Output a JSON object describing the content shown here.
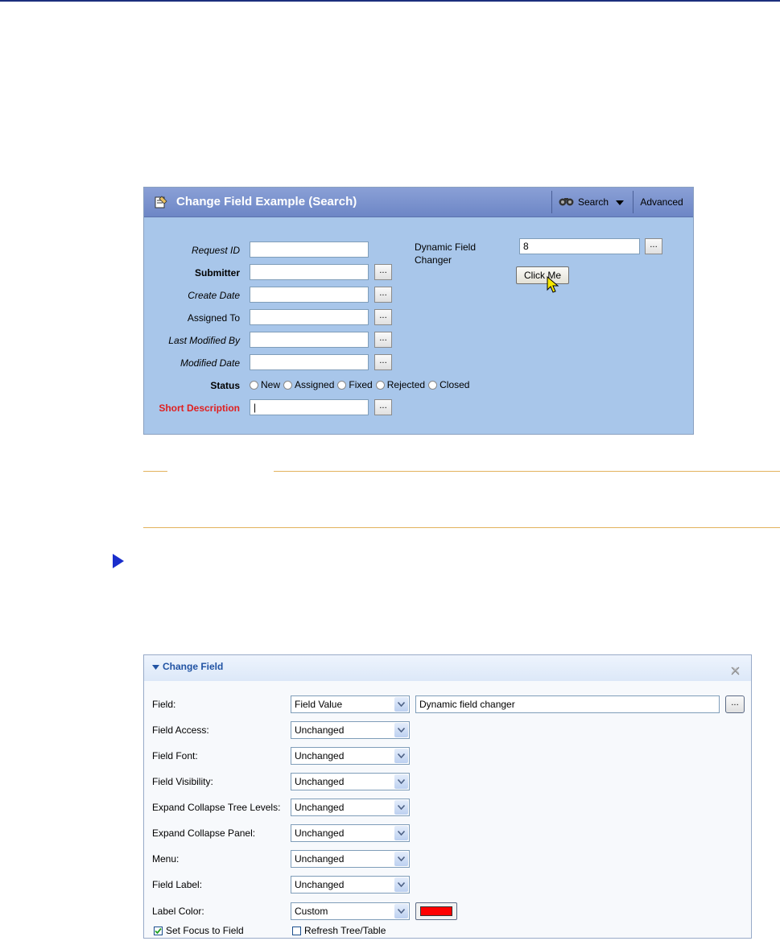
{
  "search_form": {
    "title": "Change Field Example (Search)",
    "search_label": "Search",
    "advanced_label": "Advanced",
    "fields": [
      {
        "label": "Request ID",
        "style": "italic",
        "has_button": false
      },
      {
        "label": "Submitter",
        "style": "bold",
        "has_button": true
      },
      {
        "label": "Create Date",
        "style": "italic",
        "has_button": true
      },
      {
        "label": "Assigned To",
        "style": "normal",
        "has_button": true
      },
      {
        "label": "Last Modified By",
        "style": "italic",
        "has_button": true
      },
      {
        "label": "Modified Date",
        "style": "italic",
        "has_button": true
      }
    ],
    "status": {
      "label": "Status",
      "options": [
        "New",
        "Assigned",
        "Fixed",
        "Rejected",
        "Closed"
      ]
    },
    "short_description": {
      "label": "Short Description",
      "value": "|"
    },
    "dynamic_field": {
      "label": "Dynamic Field Changer",
      "value": "8"
    },
    "click_me_label": "Click Me",
    "ellipsis": "..."
  },
  "change_field_panel": {
    "title": "Change Field",
    "rows": [
      {
        "label": "Field:",
        "value": "Field Value"
      },
      {
        "label": "Field Access:",
        "value": "Unchanged"
      },
      {
        "label": "Field Font:",
        "value": "Unchanged"
      },
      {
        "label": "Field Visibility:",
        "value": "Unchanged"
      },
      {
        "label": "Expand Collapse Tree Levels:",
        "value": "Unchanged"
      },
      {
        "label": "Expand Collapse Panel:",
        "value": "Unchanged"
      },
      {
        "label": "Menu:",
        "value": "Unchanged"
      },
      {
        "label": "Field Label:",
        "value": "Unchanged"
      },
      {
        "label": "Label Color:",
        "value": "Custom"
      }
    ],
    "field_text_value": "Dynamic field changer",
    "ellipsis": "...",
    "label_color_swatch": "#ff0000",
    "set_focus": {
      "label": "Set Focus to Field",
      "checked": true
    },
    "refresh": {
      "label": "Refresh Tree/Table",
      "checked": false
    }
  },
  "colors": {
    "form_bg": "#a8c6ea",
    "header_bg": "#7a92cf",
    "required_label": "#e02020",
    "note_rule": "#e2b25c",
    "arrow": "#1a2ecc",
    "panel_title": "#2153a3"
  }
}
